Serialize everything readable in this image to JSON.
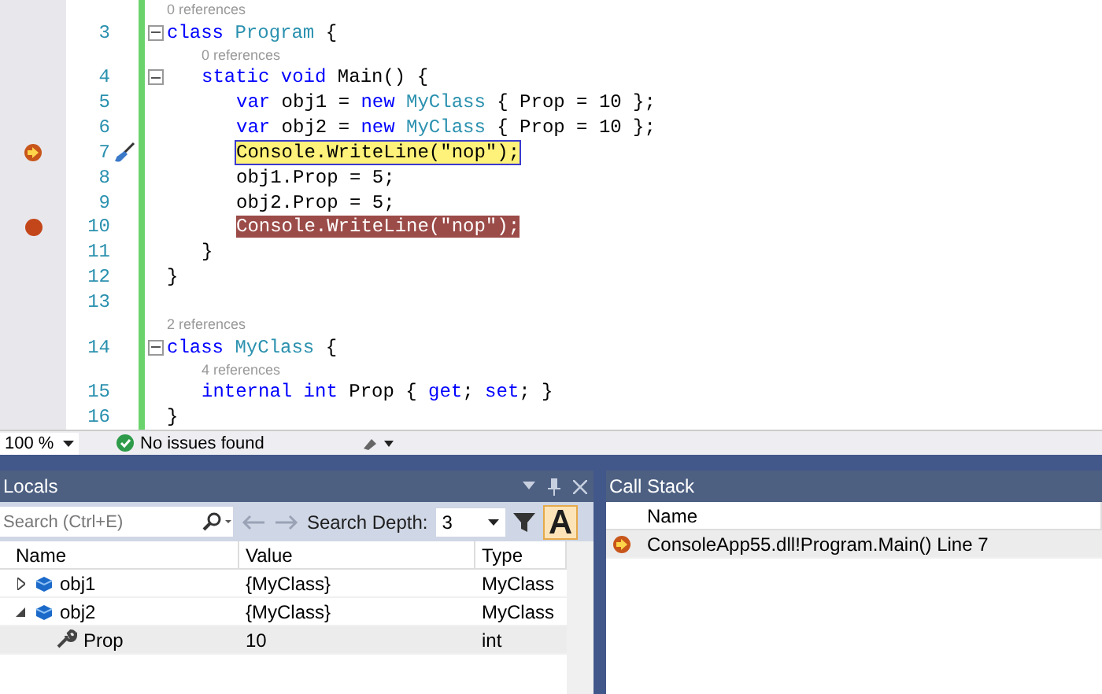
{
  "editor": {
    "lines": [
      {
        "kind": "lens",
        "text": "0 references"
      },
      {
        "kind": "code",
        "number": "3",
        "fold": true,
        "current": false,
        "breakpoint": false,
        "tokens": [
          {
            "kind": "keyword",
            "text": "class"
          },
          {
            "kind": "type",
            "text": " Program"
          },
          {
            "kind": "plain",
            "text": " {"
          }
        ],
        "children": [
          {
            "kind": "lens",
            "text": "0 references"
          },
          {
            "kind": "code",
            "number": "4",
            "fold": true,
            "current": false,
            "breakpoint": false,
            "tokens": [
              {
                "kind": "keyword",
                "text": "static void"
              },
              {
                "kind": "plain",
                "text": " Main() {"
              }
            ],
            "children": [
              {
                "kind": "code",
                "number": "5",
                "fold": false,
                "current": false,
                "breakpoint": false,
                "tokens": [
                  {
                    "kind": "keyword",
                    "text": "var"
                  },
                  {
                    "kind": "plain",
                    "text": " obj1 = "
                  },
                  {
                    "kind": "keyword",
                    "text": "new"
                  },
                  {
                    "kind": "type",
                    "text": " MyClass"
                  },
                  {
                    "kind": "plain",
                    "text": " { Prop = 10 };"
                  }
                ]
              },
              {
                "kind": "code",
                "number": "6",
                "fold": false,
                "current": false,
                "breakpoint": false,
                "tokens": [
                  {
                    "kind": "keyword",
                    "text": "var"
                  },
                  {
                    "kind": "plain",
                    "text": " obj2 = "
                  },
                  {
                    "kind": "keyword",
                    "text": "new"
                  },
                  {
                    "kind": "type",
                    "text": " MyClass"
                  },
                  {
                    "kind": "plain",
                    "text": " { Prop = 10 };"
                  }
                ]
              },
              {
                "kind": "code",
                "number": "7",
                "fold": false,
                "current": true,
                "breakpoint": false,
                "tokens": [
                  {
                    "kind": "plain",
                    "text": "Console.WriteLine(\"nop\");"
                  }
                ]
              },
              {
                "kind": "code",
                "number": "8",
                "fold": false,
                "current": false,
                "breakpoint": false,
                "tokens": [
                  {
                    "kind": "plain",
                    "text": "obj1.Prop = 5;"
                  }
                ]
              },
              {
                "kind": "code",
                "number": "9",
                "fold": false,
                "current": false,
                "breakpoint": false,
                "tokens": [
                  {
                    "kind": "plain",
                    "text": "obj2.Prop = 5;"
                  }
                ]
              },
              {
                "kind": "code",
                "number": "10",
                "fold": false,
                "current": false,
                "breakpoint": true,
                "tokens": [
                  {
                    "kind": "plain",
                    "text": "Console.WriteLine(\"nop\");"
                  }
                ]
              }
            ]
          },
          {
            "kind": "code",
            "number": "11",
            "fold": false,
            "current": false,
            "breakpoint": false,
            "tokens": [
              {
                "kind": "plain",
                "text": "}"
              }
            ]
          }
        ]
      },
      {
        "kind": "code",
        "number": "12",
        "fold": false,
        "current": false,
        "breakpoint": false,
        "tokens": [
          {
            "kind": "plain",
            "text": "}"
          }
        ]
      },
      {
        "kind": "code",
        "number": "13",
        "fold": false
      },
      {
        "kind": "lens",
        "text": "2 references"
      },
      {
        "kind": "code",
        "number": "14",
        "fold": true,
        "current": false,
        "breakpoint": false,
        "tokens": [
          {
            "kind": "keyword",
            "text": "class"
          },
          {
            "kind": "type",
            "text": " MyClass"
          },
          {
            "kind": "plain",
            "text": " {"
          }
        ],
        "children": [
          {
            "kind": "lens",
            "text": "4 references"
          },
          {
            "kind": "code",
            "number": "15",
            "fold": false,
            "current": false,
            "breakpoint": false,
            "tokens": [
              {
                "kind": "keyword",
                "text": "internal int"
              },
              {
                "kind": "plain",
                "text": " Prop { "
              },
              {
                "kind": "keyword",
                "text": "get"
              },
              {
                "kind": "plain",
                "text": "; "
              },
              {
                "kind": "keyword",
                "text": "set"
              },
              {
                "kind": "plain",
                "text": "; }"
              }
            ]
          }
        ]
      },
      {
        "kind": "code",
        "number": "16",
        "fold": false,
        "current": false,
        "breakpoint": false,
        "tokens": [
          {
            "kind": "plain",
            "text": "}"
          }
        ]
      }
    ],
    "zoom": "100 %",
    "status": "No issues found"
  },
  "locals": {
    "title": "Locals",
    "search": {
      "placeholder": "Search (Ctrl+E)"
    },
    "depth_label": "Search Depth:",
    "depth": "3",
    "hex_on": true,
    "columns": [
      "Name",
      "Value",
      "Type"
    ],
    "rows": [
      {
        "kind": "object",
        "name": "obj1",
        "value": "{MyClass}",
        "type": "MyClass",
        "expanded": false,
        "selected": false
      },
      {
        "kind": "object",
        "name": "obj2",
        "value": "{MyClass}",
        "type": "MyClass",
        "expanded": true,
        "selected": false,
        "children": [
          {
            "kind": "property",
            "name": "Prop",
            "value": "10",
            "type": "int",
            "selected": true
          }
        ]
      }
    ]
  },
  "call_stack": {
    "title": "Call Stack",
    "columns": [
      "Name"
    ],
    "rows": [
      {
        "name": "ConsoleApp55.dll!Program.Main() Line 7",
        "selected": true
      }
    ]
  }
}
